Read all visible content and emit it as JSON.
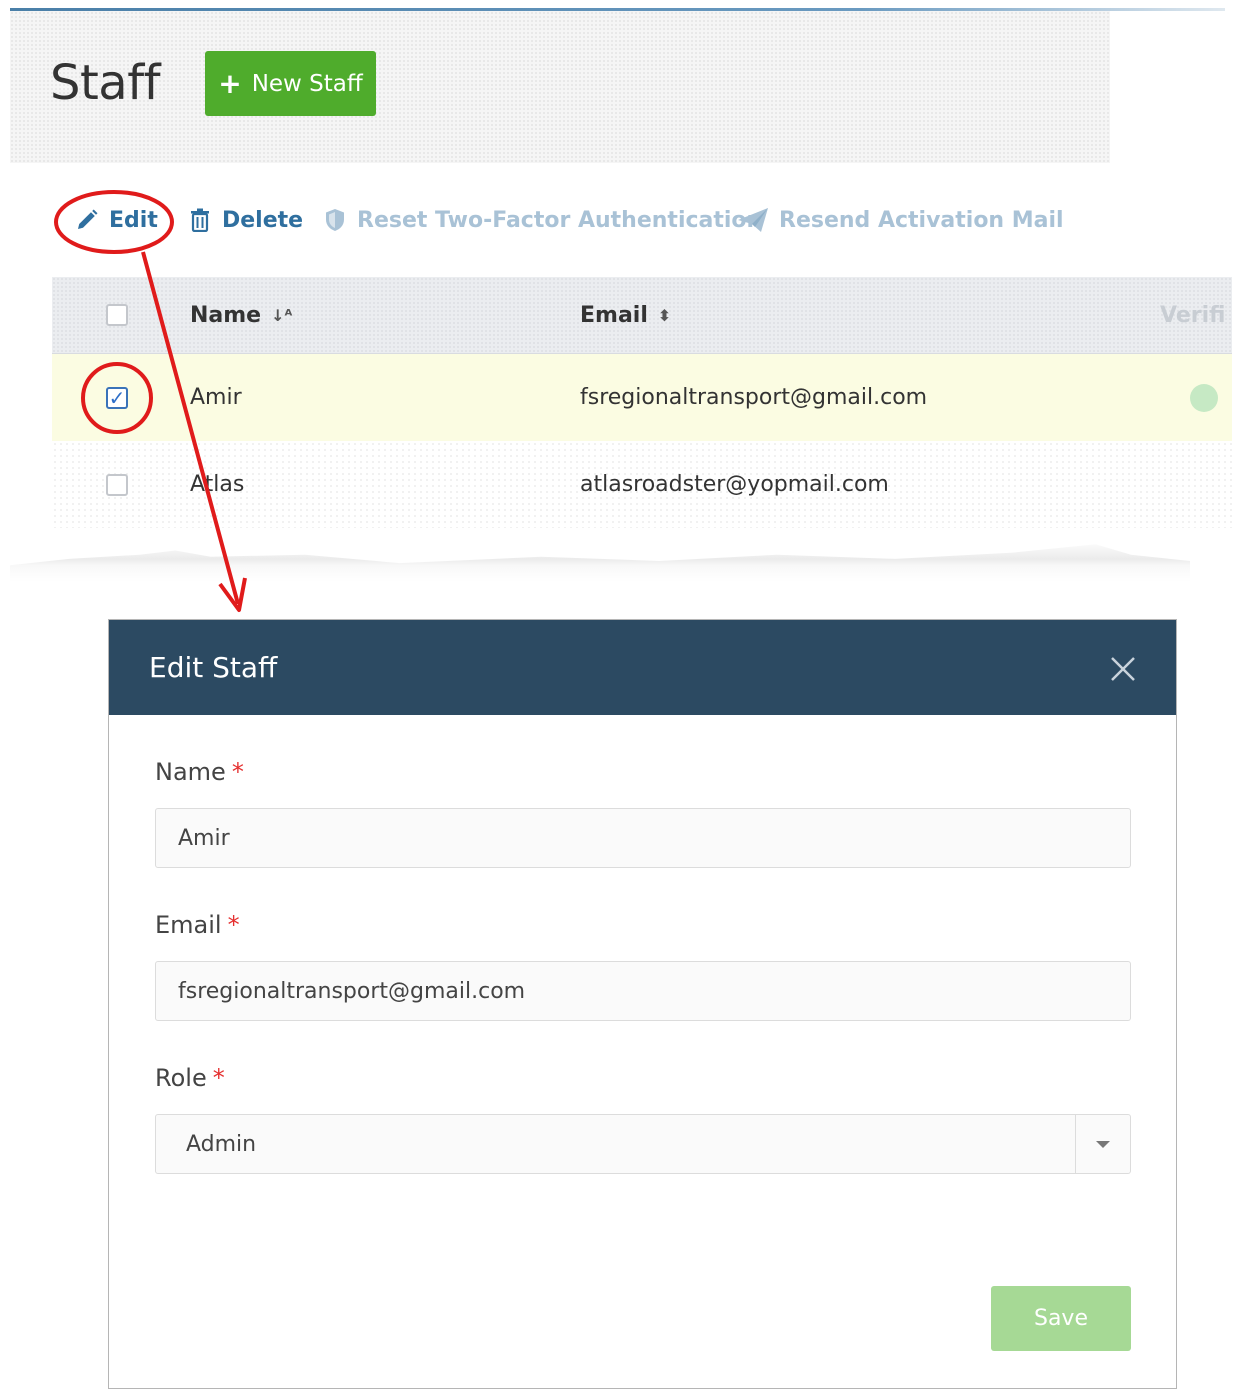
{
  "page": {
    "title": "Staff",
    "new_button_label": "New Staff"
  },
  "toolbar": {
    "edit": "Edit",
    "delete": "Delete",
    "reset_2fa": "Reset Two-Factor Authentication",
    "resend": "Resend Activation Mail"
  },
  "table": {
    "columns": {
      "name": "Name",
      "email": "Email",
      "verified": "Verifi"
    },
    "rows": [
      {
        "name": "Amir",
        "email": "fsregionaltransport@gmail.com",
        "checked": true
      },
      {
        "name": "Atlas",
        "email": "atlasroadster@yopmail.com",
        "checked": false
      }
    ]
  },
  "modal": {
    "title": "Edit Staff",
    "name_label": "Name",
    "name_value": "Amir",
    "email_label": "Email",
    "email_value": "fsregionaltransport@gmail.com",
    "role_label": "Role",
    "role_value": "Admin",
    "required_mark": "*",
    "save_label": "Save"
  },
  "colors": {
    "primary_green": "#4fac2c",
    "modal_header": "#2c4a62",
    "link_blue": "#2f6f9f",
    "annotation_red": "#e01b1b",
    "selected_row": "#fbfce2"
  }
}
